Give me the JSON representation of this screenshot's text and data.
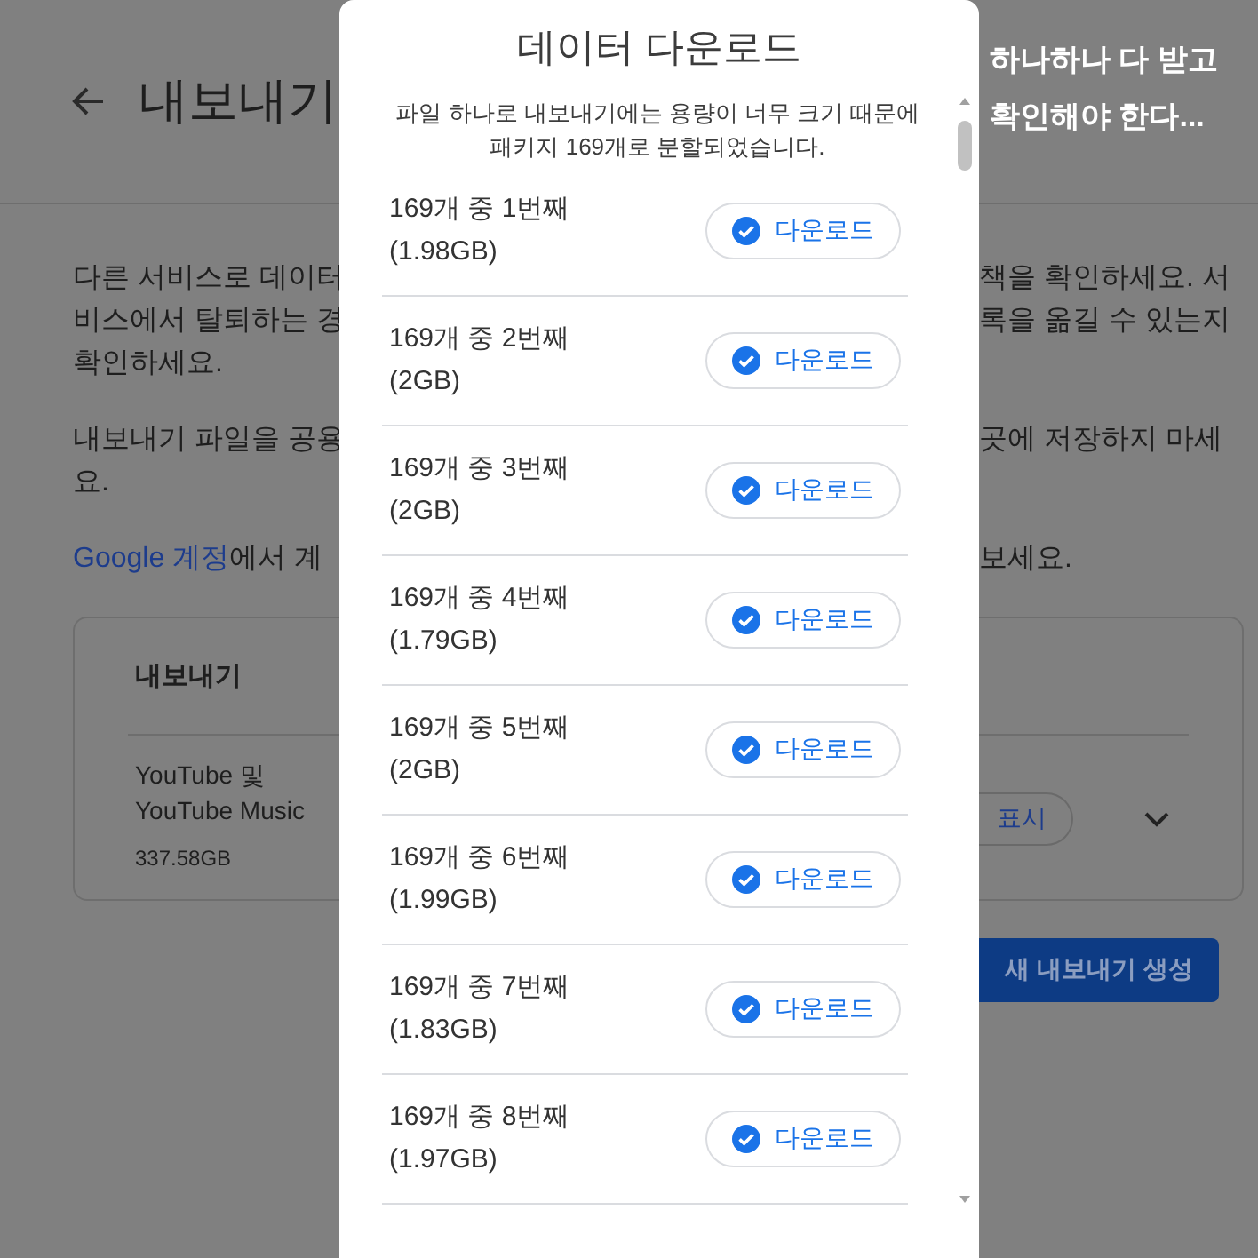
{
  "background_page": {
    "title": "내보내기",
    "paragraphs": [
      {
        "left_lines": [
          "다른 서비스로 데이터",
          "비스에서 탈퇴하는 경",
          "확인하세요."
        ],
        "right_lines": [
          "책을 확인하세요. 서",
          "록을 옮길 수 있는지"
        ]
      },
      {
        "left_lines": [
          "내보내기 파일을 공용",
          "요."
        ],
        "right_lines": [
          "곳에 저장하지 마세"
        ]
      },
      {
        "left_link": "Google 계정",
        "left_lines": [
          "에서 계"
        ],
        "right_lines": [
          "보세요."
        ]
      }
    ],
    "card": {
      "heading": "내보내기",
      "item_name_lines": [
        "YouTube 및",
        "YouTube Music"
      ],
      "item_size": "337.58GB",
      "show_button": "표시",
      "expanded": false
    },
    "create_button": "새 내보내기 생성"
  },
  "caption": [
    "하나하나 다 받고",
    "확인해야 한다..."
  ],
  "dialog": {
    "title": "데이터 다운로드",
    "description": "파일 하나로 내보내기에는 용량이 너무 크기 때문에 패키지 169개로 분할되었습니다.",
    "packages": [
      {
        "label": "169개 중 1번째",
        "size": "(1.98GB)",
        "button": "다운로드",
        "downloaded": true
      },
      {
        "label": "169개 중 2번째",
        "size": "(2GB)",
        "button": "다운로드",
        "downloaded": true
      },
      {
        "label": "169개 중 3번째",
        "size": "(2GB)",
        "button": "다운로드",
        "downloaded": true
      },
      {
        "label": "169개 중 4번째",
        "size": "(1.79GB)",
        "button": "다운로드",
        "downloaded": true
      },
      {
        "label": "169개 중 5번째",
        "size": "(2GB)",
        "button": "다운로드",
        "downloaded": true
      },
      {
        "label": "169개 중 6번째",
        "size": "(1.99GB)",
        "button": "다운로드",
        "downloaded": true
      },
      {
        "label": "169개 중 7번째",
        "size": "(1.83GB)",
        "button": "다운로드",
        "downloaded": true
      },
      {
        "label": "169개 중 8번째",
        "size": "(1.97GB)",
        "button": "다운로드",
        "downloaded": true
      }
    ]
  }
}
